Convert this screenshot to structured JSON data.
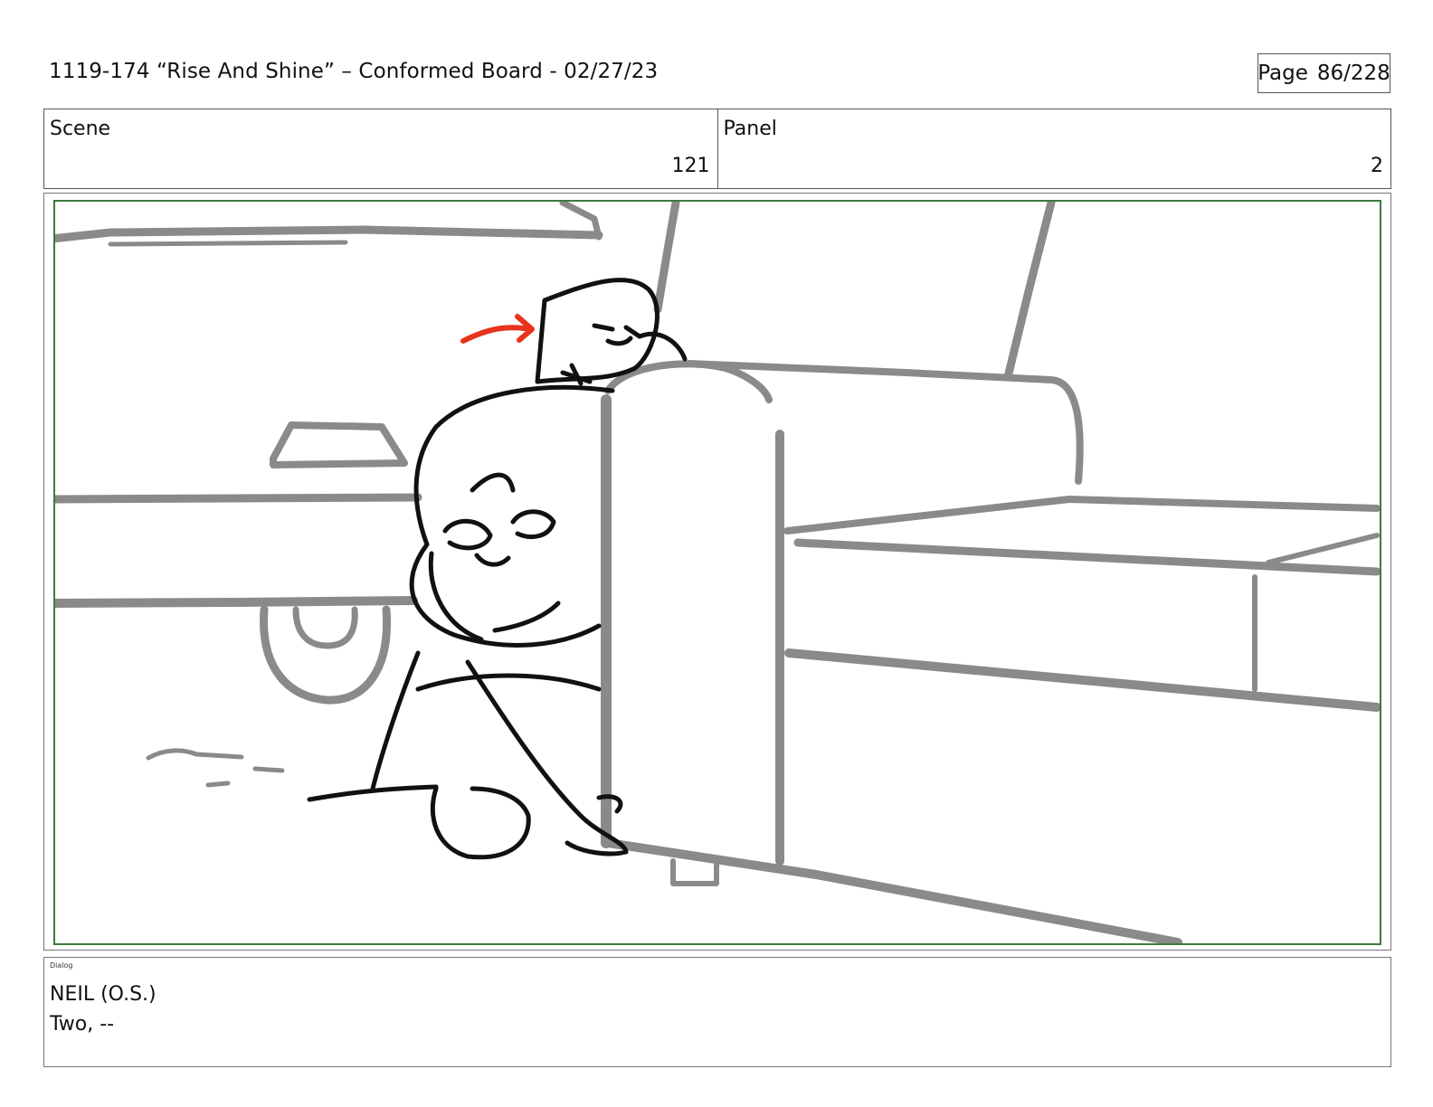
{
  "header": {
    "title": "1119-174 “Rise And Shine” – Conformed Board - 02/27/23",
    "page_label": "Page",
    "page_number": "86/228"
  },
  "info": {
    "scene_label": "Scene",
    "scene_value": "121",
    "panel_label": "Panel",
    "panel_value": "2"
  },
  "dialog": {
    "tag": "Dialog",
    "speaker": "NEIL (O.S.)",
    "line": "Two, --"
  },
  "colors": {
    "frame_border": "#3e7a3a",
    "sketch_gray": "#8a8a8a",
    "ink": "#111111",
    "arrow_red": "#e8341c"
  }
}
